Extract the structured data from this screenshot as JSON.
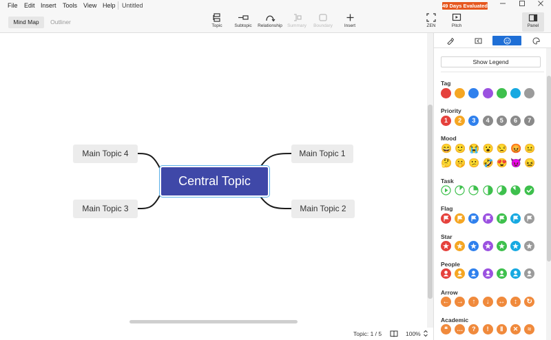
{
  "menu": {
    "items": [
      "File",
      "Edit",
      "Insert",
      "Tools",
      "View",
      "Help"
    ],
    "title": "Untitled"
  },
  "badge": "49 Days Evaluated",
  "window": {
    "minimize_icon": "minimize-icon",
    "maximize_icon": "maximize-icon",
    "close_icon": "close-icon"
  },
  "view_tabs": {
    "mind_map": "Mind Map",
    "outliner": "Outliner"
  },
  "toolbar": {
    "topic": "Topic",
    "subtopic": "Subtopic",
    "relationship": "Relationship",
    "summary": "Summary",
    "boundary": "Boundary",
    "insert": "Insert",
    "zen": "ZEN",
    "pitch": "Pitch",
    "panel": "Panel"
  },
  "mindmap": {
    "central": "Central Topic",
    "topics": [
      "Main Topic 1",
      "Main Topic 2",
      "Main Topic 3",
      "Main Topic 4"
    ],
    "line_color": "#1a1a1a",
    "central_color": "#3f48a8"
  },
  "status": {
    "topic_count": "Topic: 1 / 5",
    "zoom": "100%"
  },
  "panel": {
    "tabs": [
      "style-icon",
      "map-icon",
      "marker-icon",
      "theme-icon"
    ],
    "active_tab": "marker-icon",
    "show_legend": "Show Legend",
    "sections": {
      "tag": "Tag",
      "priority": "Priority",
      "mood": "Mood",
      "task": "Task",
      "flag": "Flag",
      "star": "Star",
      "people": "People",
      "arrow": "Arrow",
      "academic": "Academic"
    },
    "tag_colors": [
      "#e5413c",
      "#f5a623",
      "#2f80ed",
      "#9b51e0",
      "#3ec04d",
      "#17a9e1",
      "#9b9b9b"
    ],
    "priority_numbers": [
      "1",
      "2",
      "3",
      "4",
      "5",
      "6",
      "7"
    ],
    "priority_colors": [
      "#e5413c",
      "#f5a623",
      "#2f80ed",
      "#8a8a8a",
      "#8a8a8a",
      "#8a8a8a",
      "#8a8a8a"
    ],
    "mood": [
      "😄",
      "🙂",
      "😭",
      "😮",
      "😒",
      "😡",
      "😐",
      "🤔",
      "🤫",
      "😕",
      "🤣",
      "😍",
      "😈",
      "😖"
    ],
    "task_progress": [
      0,
      0.125,
      0.25,
      0.5,
      0.625,
      0.875,
      1
    ],
    "flag_colors": [
      "#e5413c",
      "#f5a623",
      "#2f80ed",
      "#9b51e0",
      "#3ec04d",
      "#17a9e1",
      "#9b9b9b"
    ],
    "star_colors": [
      "#e5413c",
      "#f5a623",
      "#2f80ed",
      "#9b51e0",
      "#3ec04d",
      "#17a9e1",
      "#9b9b9b"
    ],
    "people_colors": [
      "#e5413c",
      "#f5a623",
      "#2f80ed",
      "#9b51e0",
      "#3ec04d",
      "#17a9e1",
      "#9b9b9b"
    ],
    "arrow_color": "#f08a3c",
    "arrow_glyphs": [
      "←",
      "→",
      "↑",
      "↓",
      "↔",
      "↕",
      "↻"
    ],
    "academic_color": "#f08a3c",
    "academic_glyphs": [
      "❝",
      "…",
      "?",
      "!",
      "Ⅱ",
      "✕",
      "≈"
    ]
  }
}
